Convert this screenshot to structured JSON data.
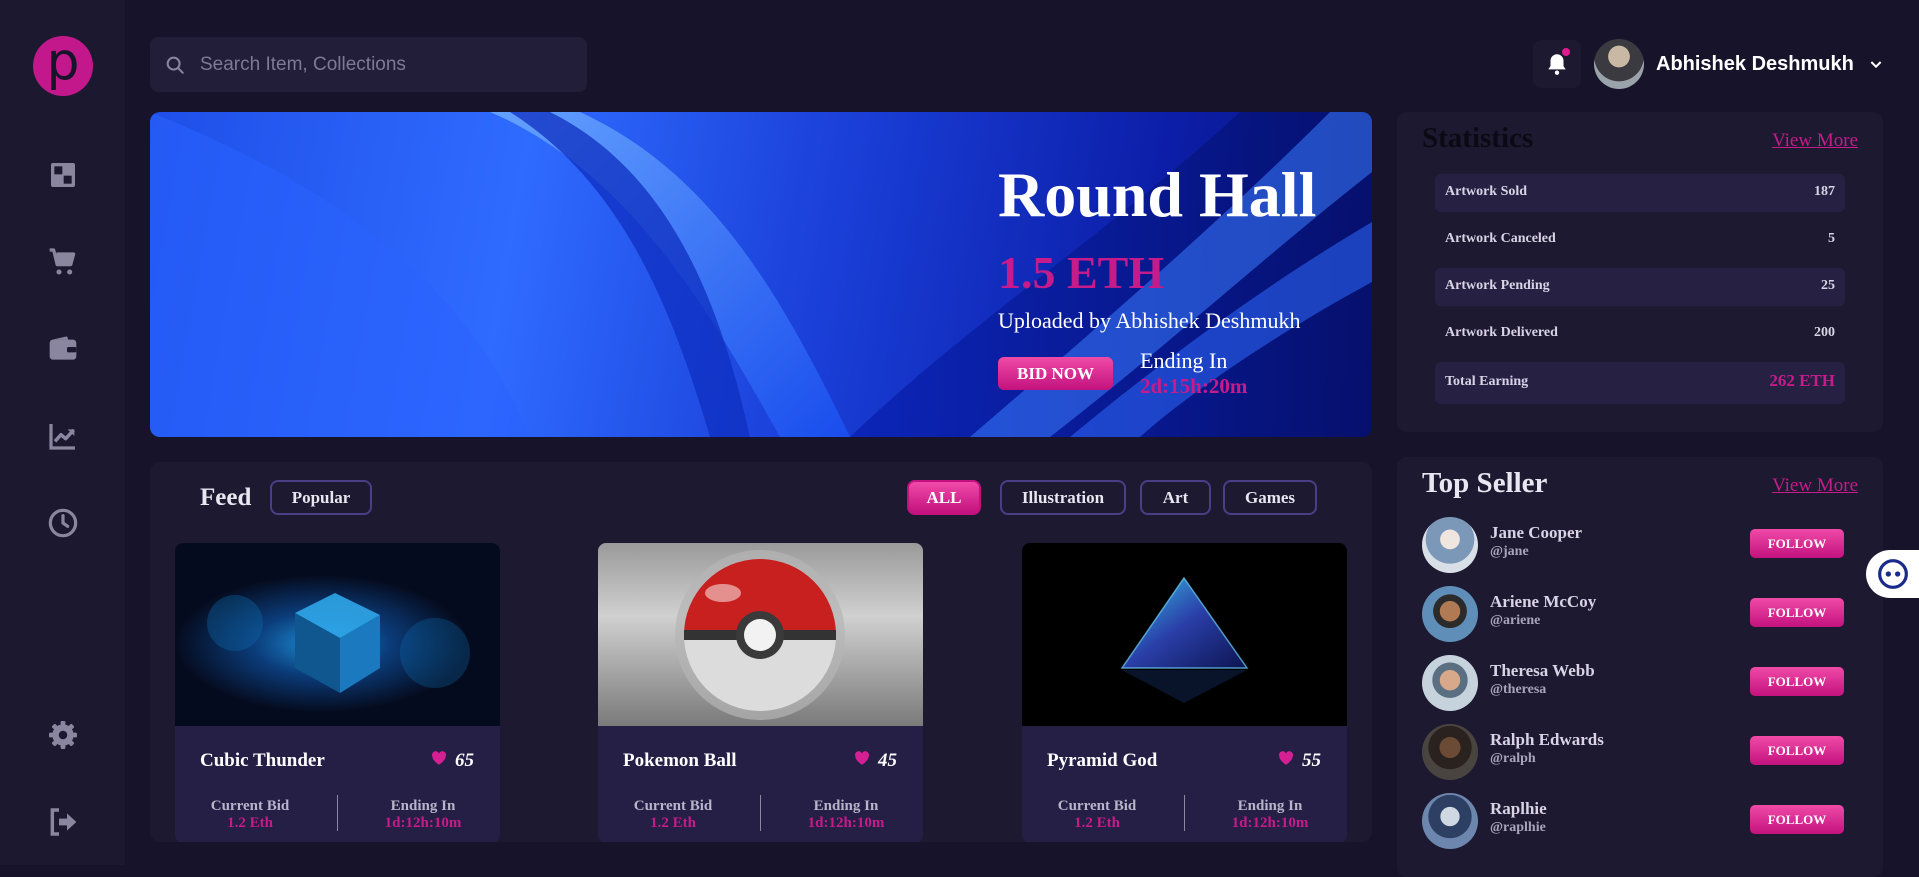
{
  "brand": {
    "logo_letter": "p"
  },
  "sidebar": {
    "items": [
      {
        "name": "dashboard",
        "icon": "dashboard-icon"
      },
      {
        "name": "market",
        "icon": "cart-icon"
      },
      {
        "name": "wallet",
        "icon": "wallet-icon"
      },
      {
        "name": "analytics",
        "icon": "chart-icon"
      },
      {
        "name": "history",
        "icon": "clock-icon"
      },
      {
        "name": "settings",
        "icon": "gear-icon"
      },
      {
        "name": "logout",
        "icon": "logout-icon"
      }
    ]
  },
  "search": {
    "placeholder": "Search Item, Collections",
    "value": ""
  },
  "header": {
    "user_name": "Abhishek Deshmukh"
  },
  "hero": {
    "title": "Round Hall",
    "price": "1.5 ETH",
    "uploader": "Uploaded by Abhishek Deshmukh",
    "bid_label": "BID NOW",
    "ending_label": "Ending In",
    "ending_time": "2d:15h:20m"
  },
  "feed": {
    "title": "Feed",
    "sort_label": "Popular",
    "filters": [
      "ALL",
      "Illustration",
      "Art",
      "Games"
    ],
    "active_filter": "ALL",
    "cards": [
      {
        "name": "Cubic Thunder",
        "likes": "65",
        "bid_label": "Current Bid",
        "bid": "1.2 Eth",
        "end_label": "Ending In",
        "end": "1d:12h:10m"
      },
      {
        "name": "Pokemon Ball",
        "likes": "45",
        "bid_label": "Current Bid",
        "bid": "1.2 Eth",
        "end_label": "Ending In",
        "end": "1d:12h:10m"
      },
      {
        "name": "Pyramid God",
        "likes": "55",
        "bid_label": "Current Bid",
        "bid": "1.2 Eth",
        "end_label": "Ending In",
        "end": "1d:12h:10m"
      }
    ]
  },
  "statistics": {
    "title": "Statistics",
    "view_more": "View More",
    "rows": [
      {
        "label": "Artwork Sold",
        "value": "187"
      },
      {
        "label": "Artwork Canceled",
        "value": "5"
      },
      {
        "label": "Artwork Pending",
        "value": "25"
      },
      {
        "label": "Artwork Delivered",
        "value": "200"
      },
      {
        "label": "Total Earning",
        "value": "262 ETH"
      }
    ]
  },
  "top_seller": {
    "title": "Top Seller",
    "view_more": "View More",
    "follow_label": "FOLLOW",
    "sellers": [
      {
        "name": "Jane Cooper",
        "handle": "@jane"
      },
      {
        "name": "Ariene McCoy",
        "handle": "@ariene"
      },
      {
        "name": "Theresa Webb",
        "handle": "@theresa"
      },
      {
        "name": "Ralph Edwards",
        "handle": "@ralph"
      },
      {
        "name": "Raplhie",
        "handle": "@raplhie"
      }
    ]
  },
  "colors": {
    "accent": "#c61b8a",
    "background": "#17132a",
    "panel": "#1d1930"
  }
}
